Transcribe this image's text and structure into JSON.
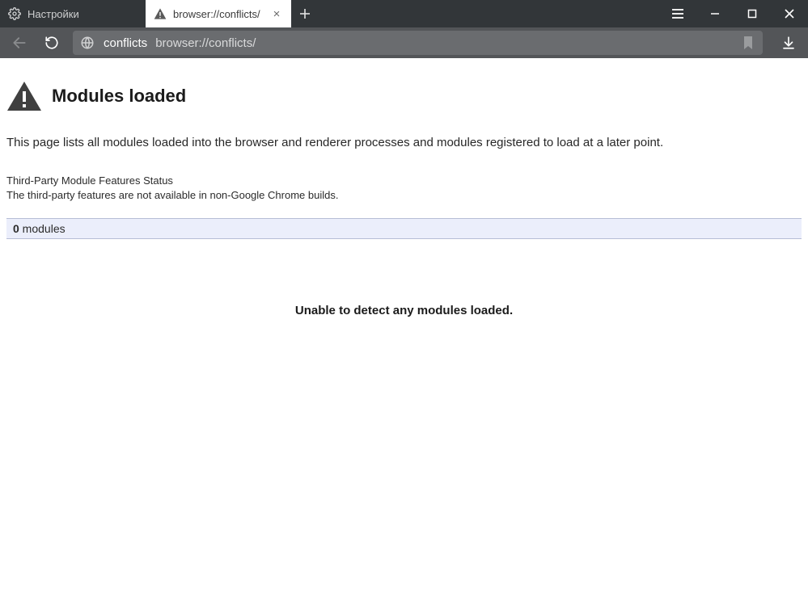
{
  "tabs": [
    {
      "label": "Настройки",
      "active": false
    },
    {
      "label": "browser://conflicts/",
      "active": true
    }
  ],
  "address": {
    "site_name": "conflicts",
    "url": "browser://conflicts/"
  },
  "page": {
    "title": "Modules loaded",
    "description": "This page lists all modules loaded into the browser and renderer processes and modules registered to load at a later point.",
    "status_heading": "Third-Party Module Features Status",
    "status_text": "The third-party features are not available in non-Google Chrome builds.",
    "modules_count": "0",
    "modules_label": " modules",
    "nomodules_text": "Unable to detect any modules loaded."
  }
}
